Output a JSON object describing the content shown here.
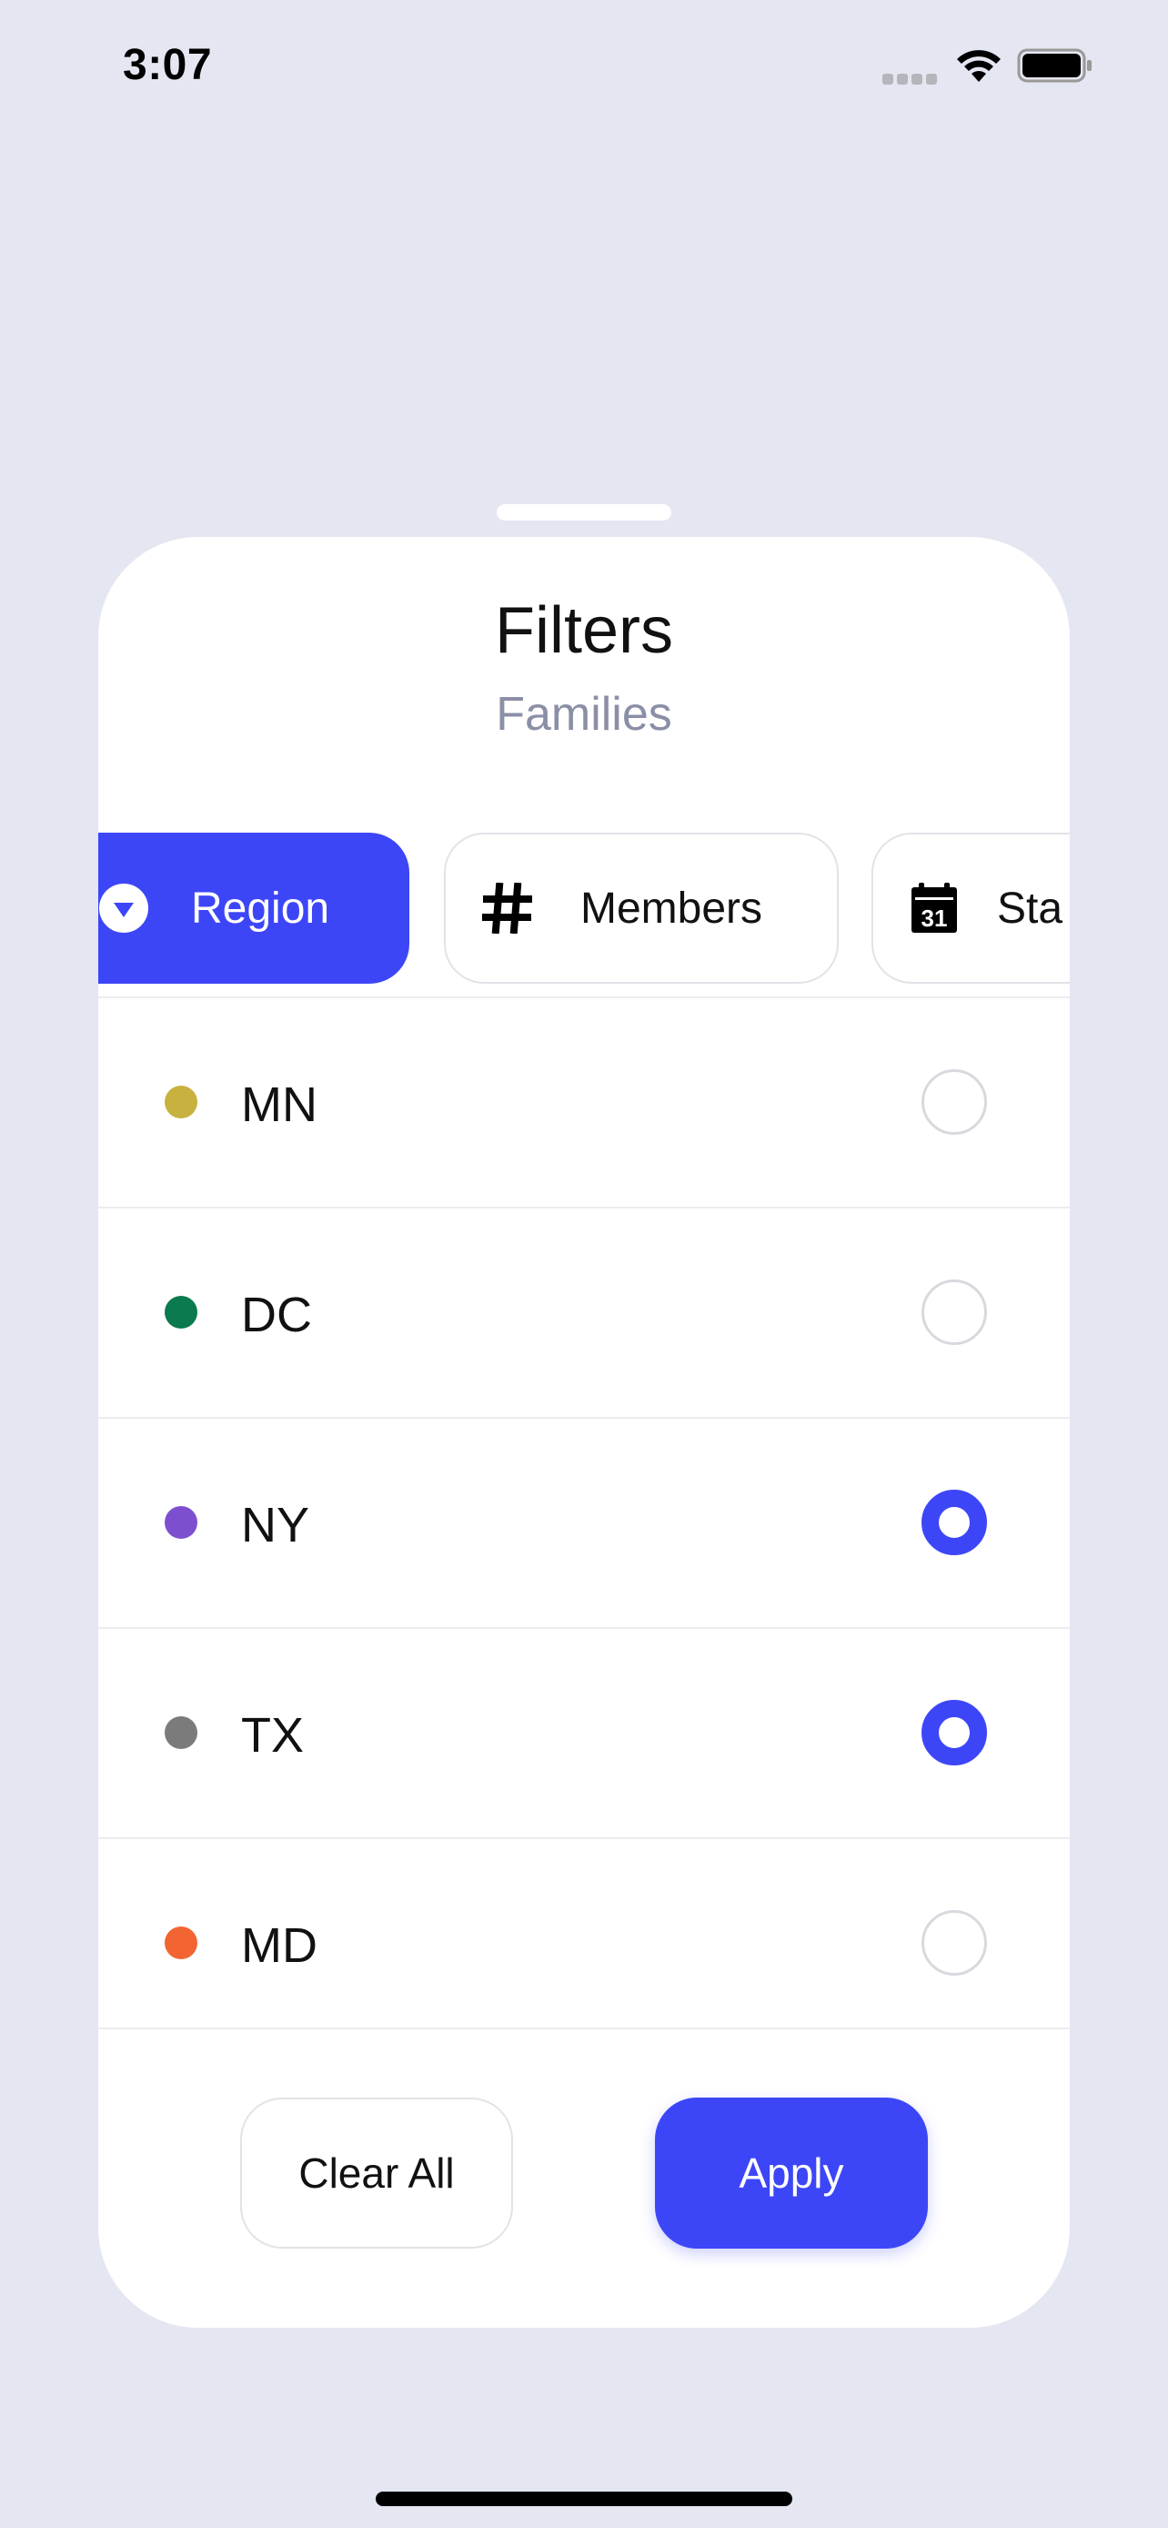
{
  "status_bar": {
    "time": "3:07"
  },
  "sheet": {
    "title": "Filters",
    "subtitle": "Families",
    "tabs": [
      {
        "label": "Region",
        "icon": "chevron-down-circle-icon",
        "selected": true
      },
      {
        "label": "Members",
        "icon": "hashtag-icon",
        "selected": false
      },
      {
        "label": "Sta",
        "icon": "calendar-icon",
        "icon_text": "31",
        "selected": false
      }
    ],
    "options": [
      {
        "label": "MN",
        "color": "#c8b13f",
        "checked": false
      },
      {
        "label": "DC",
        "color": "#0b7a4e",
        "checked": false
      },
      {
        "label": "NY",
        "color": "#7d4fd0",
        "checked": true
      },
      {
        "label": "TX",
        "color": "#7b7b7b",
        "checked": true
      },
      {
        "label": "MD",
        "color": "#f26532",
        "checked": false
      }
    ],
    "clear_label": "Clear All",
    "apply_label": "Apply"
  },
  "colors": {
    "accent": "#3d46f7",
    "background": "#e4e6f1"
  }
}
